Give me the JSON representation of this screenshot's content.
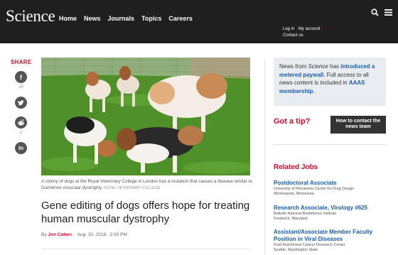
{
  "header": {
    "logo": "Science",
    "nav": [
      "Home",
      "News",
      "Journals",
      "Topics",
      "Careers"
    ],
    "account_links": {
      "login": "Log in",
      "my_account": "My account",
      "contact": "Contact us"
    },
    "search_icon": "search-icon",
    "menu_icon": "menu-icon"
  },
  "share": {
    "title": "SHARE",
    "items": [
      {
        "icon": "facebook-icon",
        "glyph": "f",
        "count": "16"
      },
      {
        "icon": "twitter-icon",
        "glyph": "t",
        "count": ""
      },
      {
        "icon": "reddit-icon",
        "glyph": "r",
        "count": "2"
      },
      {
        "icon": "linkedin-icon",
        "glyph": "in",
        "count": ""
      }
    ]
  },
  "article": {
    "caption": "A colony of dogs at the Royal Veterinary College in London has a mutation that causes a disease similar to Duchenne muscular dystrophy.",
    "credit": "ROYAL VETERINARY COLLEGE",
    "headline": "Gene editing of dogs offers hope for treating human muscular dystrophy",
    "byline_prefix": "By",
    "author": "Jon Cohen",
    "date": "Aug. 30, 2018 , 2:00 PM"
  },
  "sidebar": {
    "paywall": {
      "part1": "News from ",
      "source": "Science",
      "part2": " has ",
      "link1": "introduced a metered paywall",
      "part3": ". Full access to all news content is included in ",
      "link2": "AAAS membership",
      "part4": "."
    },
    "tip": {
      "title": "Got a tip?",
      "button": "How to contact the news team"
    },
    "jobs": {
      "title": "Related Jobs",
      "items": [
        {
          "title": "Postdoctoral Associate",
          "employer": "University of Minnesota Center for Drug Design",
          "location": "Minneapolis, Minnesota"
        },
        {
          "title": "Research Associate, Virology #625",
          "employer": "Battelle National Biodefense Institute",
          "location": "Frederick, Maryland"
        },
        {
          "title": "Assistant/Associate Member Faculty Position in Viral Diseases",
          "employer": "Fred Hutchinson Cancer Research Center",
          "location": "Seattle, Washington State"
        }
      ]
    }
  },
  "colors": {
    "brand_red": "#c8102e",
    "link_blue": "#1a5ea8",
    "header_bg": "#1f1f1f"
  }
}
